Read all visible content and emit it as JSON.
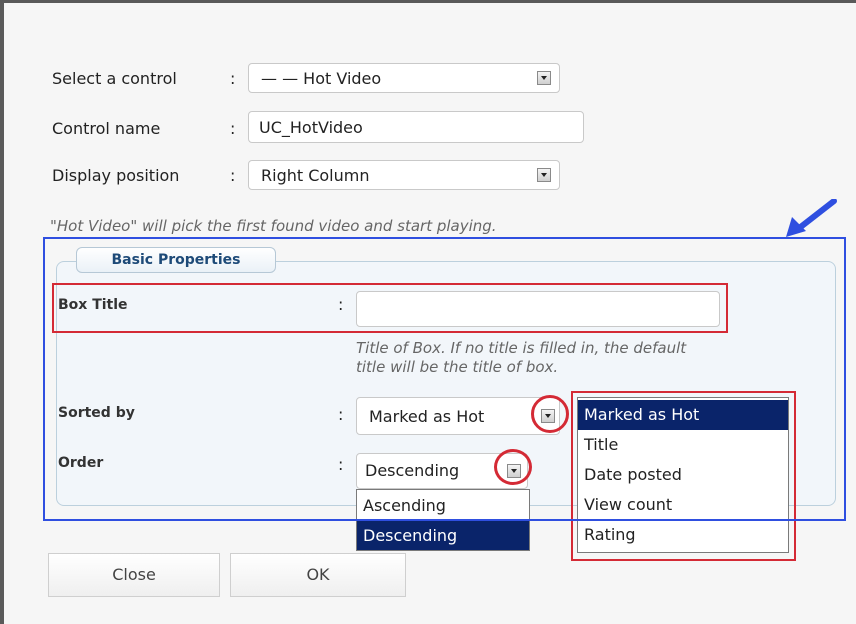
{
  "form": {
    "select_control_label": "Select a control",
    "select_control_value": "— — Hot Video",
    "control_name_label": "Control name",
    "control_name_value": "UC_HotVideo",
    "display_position_label": "Display position",
    "display_position_value": "Right Column",
    "colon": ":",
    "hint": "\"Hot Video\" will pick the first found video and start playing."
  },
  "basic_properties": {
    "legend": "Basic Properties",
    "box_title_label": "Box Title",
    "box_title_value": "",
    "box_title_help_line1": "Title of Box. If no title is filled in, the default",
    "box_title_help_line2": "title will be the title of box.",
    "sorted_by_label": "Sorted by",
    "sorted_by_value": "Marked as Hot",
    "order_label": "Order",
    "order_value": "Descending"
  },
  "order_options": [
    "Ascending",
    "Descending"
  ],
  "order_selected_index": 1,
  "sort_options": [
    "Marked as Hot",
    "Title",
    "Date posted",
    "View count",
    "Rating"
  ],
  "sort_selected_index": 0,
  "buttons": {
    "close": "Close",
    "ok": "OK"
  },
  "colors": {
    "annotation_red": "#d42a35",
    "annotation_blue": "#2f4fe0",
    "selection": "#0a246a"
  }
}
